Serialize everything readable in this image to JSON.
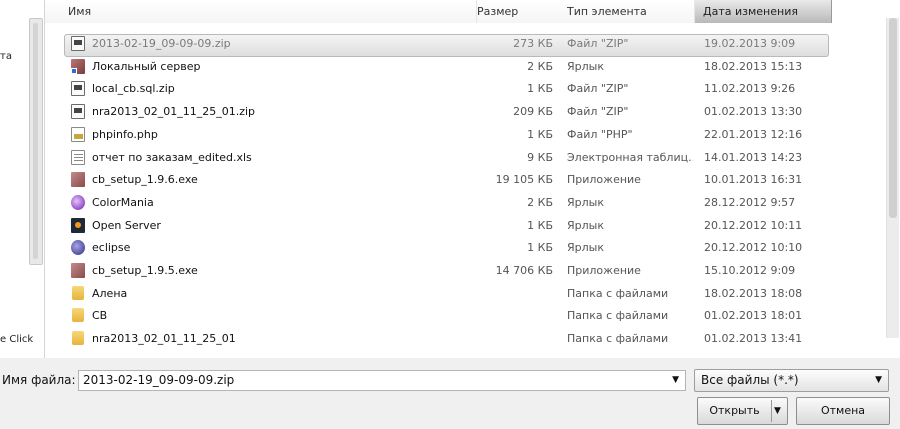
{
  "left_pane": {
    "fragments": [
      "та",
      "e Click"
    ]
  },
  "columns": {
    "name": "Имя",
    "size": "Размер",
    "type": "Тип элемента",
    "date": "Дата изменения"
  },
  "files": [
    {
      "name": "2013-02-19_09-09-09.zip",
      "size": "273 КБ",
      "type": "Файл \"ZIP\"",
      "date": "19.02.2013 9:09",
      "icon": "zip-icon",
      "selected": true
    },
    {
      "name": "Локальный сервер",
      "size": "2 КБ",
      "type": "Ярлык",
      "date": "18.02.2013 15:13",
      "icon": "shortcut-icon"
    },
    {
      "name": "local_cb.sql.zip",
      "size": "1 КБ",
      "type": "Файл \"ZIP\"",
      "date": "11.02.2013 9:26",
      "icon": "zip-icon"
    },
    {
      "name": "nra2013_02_01_11_25_01.zip",
      "size": "209 КБ",
      "type": "Файл \"ZIP\"",
      "date": "01.02.2013 13:30",
      "icon": "zip-icon"
    },
    {
      "name": "phpinfo.php",
      "size": "1 КБ",
      "type": "Файл \"PHP\"",
      "date": "22.01.2013 12:16",
      "icon": "php-file-icon"
    },
    {
      "name": "отчет по заказам_edited.xls",
      "size": "9 КБ",
      "type": "Электронная таблиц...",
      "date": "14.01.2013 14:23",
      "icon": "spreadsheet-icon"
    },
    {
      "name": "cb_setup_1.9.6.exe",
      "size": "19 105 КБ",
      "type": "Приложение",
      "date": "10.01.2013 16:31",
      "icon": "installer-icon"
    },
    {
      "name": "ColorMania",
      "size": "2 КБ",
      "type": "Ярлык",
      "date": "28.12.2012 9:57",
      "icon": "colormania-icon"
    },
    {
      "name": "Open Server",
      "size": "1 КБ",
      "type": "Ярлык",
      "date": "20.12.2012 10:11",
      "icon": "open-server-icon"
    },
    {
      "name": "eclipse",
      "size": "1 КБ",
      "type": "Ярлык",
      "date": "20.12.2012 10:10",
      "icon": "eclipse-icon"
    },
    {
      "name": "cb_setup_1.9.5.exe",
      "size": "14 706 КБ",
      "type": "Приложение",
      "date": "15.10.2012 9:09",
      "icon": "installer-icon"
    },
    {
      "name": "Алена",
      "size": "",
      "type": "Папка с файлами",
      "date": "18.02.2013 18:08",
      "icon": "folder-icon"
    },
    {
      "name": "CB",
      "size": "",
      "type": "Папка с файлами",
      "date": "01.02.2013 18:01",
      "icon": "folder-icon"
    },
    {
      "name": "nra2013_02_01_11_25_01",
      "size": "",
      "type": "Папка с файлами",
      "date": "01.02.2013 13:41",
      "icon": "folder-icon"
    }
  ],
  "filename_label": "Имя файла:",
  "filename_value": "2013-02-19_09-09-09.zip",
  "filter_value": "Все файлы (*.*)",
  "buttons": {
    "open": "Открыть",
    "cancel": "Отмена"
  }
}
